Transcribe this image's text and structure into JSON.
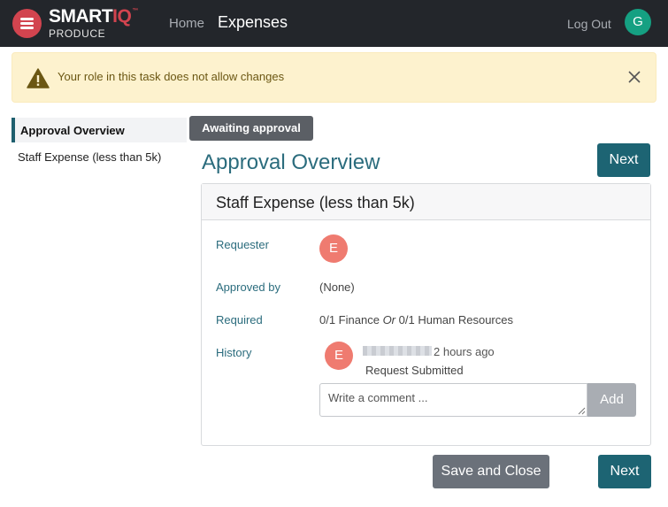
{
  "header": {
    "brand_main": "SMART",
    "brand_accent": "IQ",
    "brand_tm": "™",
    "brand_sub": "PRODUCE",
    "nav_home": "Home",
    "nav_current": "Expenses",
    "logout_label": "Log Out",
    "user_initial": "G"
  },
  "alert": {
    "message": "Your role in this task does not allow changes",
    "icon": "warning-icon"
  },
  "sidebar": {
    "items": [
      {
        "label": "Approval Overview",
        "active": true
      },
      {
        "label": "Staff Expense (less than 5k)",
        "active": false
      }
    ]
  },
  "main": {
    "status_badge": "Awaiting approval",
    "title": "Approval Overview",
    "next_label": "Next",
    "card": {
      "title": "Staff Expense (less than 5k)",
      "requester_label": "Requester",
      "requester_initial": "E",
      "approved_by_label": "Approved by",
      "approved_by_value": "(None)",
      "required_label": "Required",
      "required_part1": "0/1 Finance",
      "required_or": "Or",
      "required_part2": "0/1 Human Resources",
      "history_label": "History",
      "history_initial": "E",
      "history_time": "2 hours ago",
      "history_event": "Request Submitted",
      "comment_placeholder": "Write a comment ...",
      "add_label": "Add"
    },
    "save_close_label": "Save and Close"
  },
  "colors": {
    "topbar": "#23262b",
    "brand_red": "#d2444f",
    "teal": "#1d6473",
    "avatar_green": "#15a082",
    "avatar_salmon": "#ef7b70",
    "alert_bg": "#fdf2ce"
  }
}
